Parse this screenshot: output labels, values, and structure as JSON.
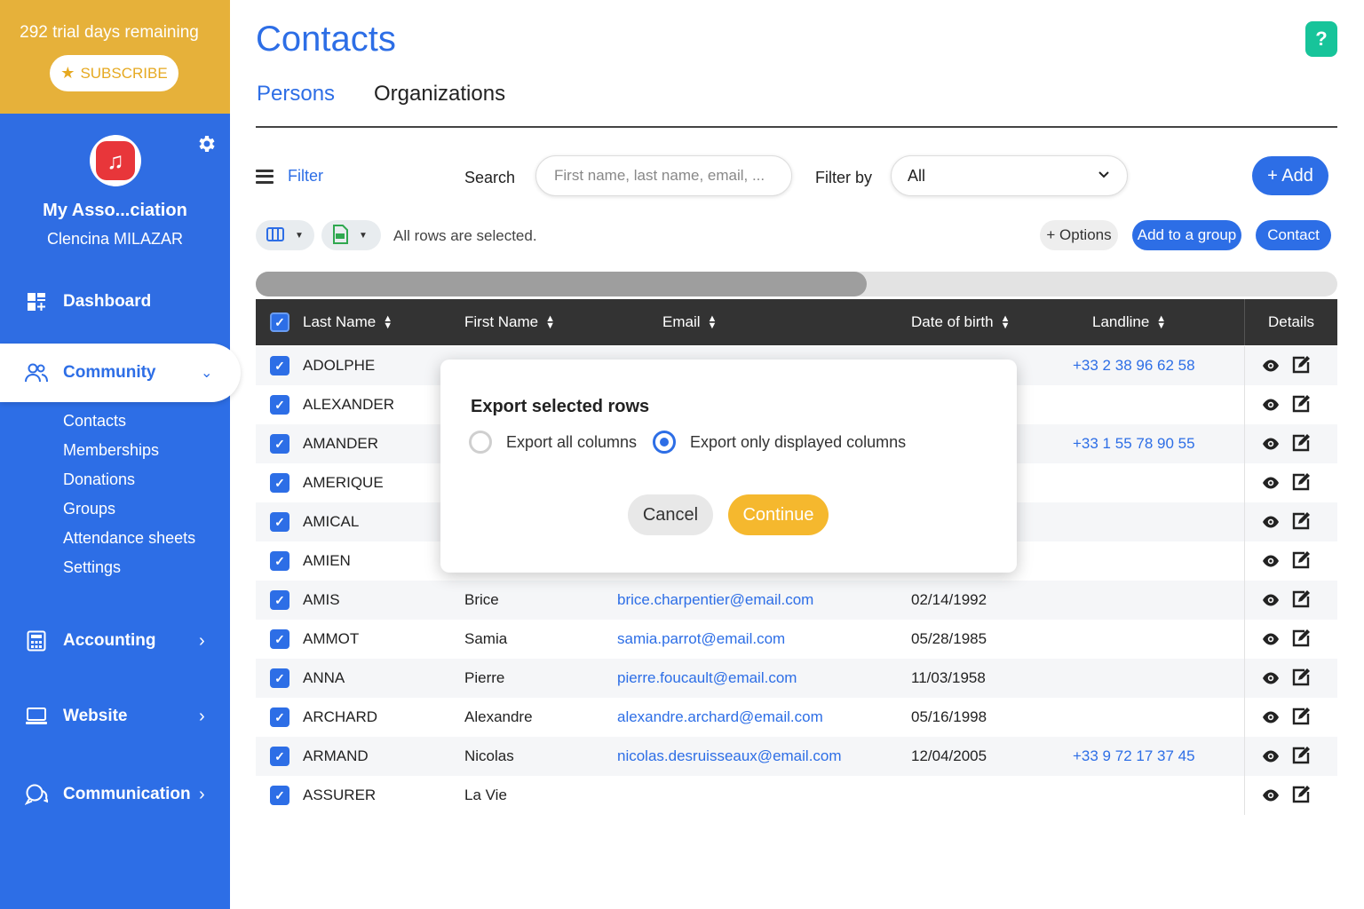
{
  "trial": {
    "days_text": "292 trial days remaining",
    "subscribe_label": "SUBSCRIBE"
  },
  "organization": {
    "name": "My Asso...ciation",
    "user": "Clencina MILAZAR"
  },
  "nav": {
    "dashboard": "Dashboard",
    "community": "Community",
    "community_sub": [
      "Contacts",
      "Memberships",
      "Donations",
      "Groups",
      "Attendance sheets",
      "Settings"
    ],
    "accounting": "Accounting",
    "website": "Website",
    "communication": "Communication"
  },
  "header": {
    "title": "Contacts",
    "help": "?",
    "tabs": [
      "Persons",
      "Organizations"
    ],
    "active_tab": "Persons"
  },
  "toolbar": {
    "filter_label": "Filter",
    "search_label": "Search",
    "search_placeholder": "First name, last name, email, ...",
    "search_value": "",
    "filterby_label": "Filter by",
    "filterby_value": "All",
    "add_label": "+ Add",
    "selected_text": "All rows are selected.",
    "options_label": "+ Options",
    "add_group_label": "Add to a group",
    "contact_label": "Contact"
  },
  "scroll": {
    "position_fraction": 0.565
  },
  "table": {
    "columns": [
      "Last Name",
      "First Name",
      "Email",
      "Date of birth",
      "Landline",
      "Details"
    ],
    "rows": [
      {
        "last": "ADOLPHE",
        "first": "",
        "email": "",
        "dob": "",
        "landline": "+33 2 38 96 62 58",
        "checked": true
      },
      {
        "last": "ALEXANDER",
        "first": "",
        "email": "",
        "dob": "",
        "landline": "",
        "checked": true
      },
      {
        "last": "AMANDER",
        "first": "",
        "email": "",
        "dob": "",
        "landline": "+33 1 55 78 90 55",
        "checked": true
      },
      {
        "last": "AMERIQUE",
        "first": "",
        "email": "",
        "dob": "",
        "landline": "",
        "checked": true
      },
      {
        "last": "AMICAL",
        "first": "",
        "email": "",
        "dob": "",
        "landline": "",
        "checked": true
      },
      {
        "last": "AMIEN",
        "first": "",
        "email": "",
        "dob": "",
        "landline": "",
        "checked": true
      },
      {
        "last": "AMIS",
        "first": "Brice",
        "email": "brice.charpentier@email.com",
        "dob": "02/14/1992",
        "landline": "",
        "checked": true
      },
      {
        "last": "AMMOT",
        "first": "Samia",
        "email": "samia.parrot@email.com",
        "dob": "05/28/1985",
        "landline": "",
        "checked": true
      },
      {
        "last": "ANNA",
        "first": "Pierre",
        "email": "pierre.foucault@email.com",
        "dob": "11/03/1958",
        "landline": "",
        "checked": true
      },
      {
        "last": "ARCHARD",
        "first": "Alexandre",
        "email": "alexandre.archard@email.com",
        "dob": "05/16/1998",
        "landline": "",
        "checked": true
      },
      {
        "last": "ARMAND",
        "first": "Nicolas",
        "email": "nicolas.desruisseaux@email.com",
        "dob": "12/04/2005",
        "landline": "+33 9 72 17 37 45",
        "checked": true
      },
      {
        "last": "ASSURER",
        "first": "La Vie",
        "email": "",
        "dob": "",
        "landline": "",
        "checked": true
      }
    ]
  },
  "modal": {
    "title": "Export selected rows",
    "option_all": "Export all columns",
    "option_displayed": "Export only displayed columns",
    "selected_option": "Export only displayed columns",
    "cancel_label": "Cancel",
    "continue_label": "Continue"
  },
  "colors": {
    "primary": "#2d6ee6",
    "trial_bg": "#e6b13a",
    "help": "#17c49a",
    "continue": "#f5b82e",
    "table_header": "#333333"
  },
  "icons": {
    "dashboard": "dashboard-icon",
    "community": "users-icon",
    "accounting": "calculator-icon",
    "website": "laptop-icon",
    "communication": "chat-icon",
    "settings": "gear-icon",
    "subscribe": "star-icon"
  }
}
